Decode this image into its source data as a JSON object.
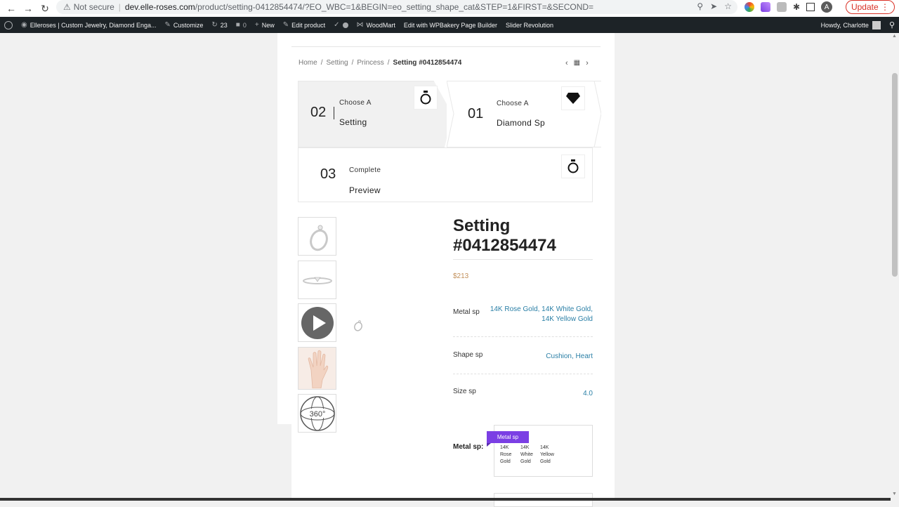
{
  "browser": {
    "security": "Not secure",
    "url_host": "dev.elle-roses.com",
    "url_path": "/product/setting-0412854474/?EO_WBC=1&BEGIN=eo_setting_shape_cat&STEP=1&FIRST=&SECOND=",
    "avatar_letter": "A",
    "update_label": "Update"
  },
  "adminbar": {
    "site": "Elleroses | Custom Jewelry, Diamond Enga...",
    "customize": "Customize",
    "updates": "23",
    "comments": "0",
    "new": "New",
    "edit_product": "Edit product",
    "woodmart": "WoodMart",
    "wpbakery": "Edit with WPBakery Page Builder",
    "slider": "Slider Revolution",
    "howdy": "Howdy, Charlotte"
  },
  "breadcrumb": {
    "home": "Home",
    "sep": "/",
    "setting": "Setting",
    "princess": "Princess",
    "current": "Setting #0412854474"
  },
  "steps": [
    {
      "num": "02",
      "label": "Choose A",
      "title": "Setting"
    },
    {
      "num": "01",
      "label": "Choose A",
      "title": "Diamond Sp"
    },
    {
      "num": "03",
      "label": "Complete",
      "title": "Preview"
    }
  ],
  "product": {
    "title": "Setting #0412854474",
    "price": "$213",
    "attributes": [
      {
        "label": "Metal sp",
        "value_line1": "14K Rose Gold, 14K White Gold,",
        "value_line2": "14K Yellow Gold"
      },
      {
        "label": "Shape sp",
        "value_line1": "Cushion, Heart",
        "value_line2": ""
      },
      {
        "label": "Size sp",
        "value_line1": "4.0",
        "value_line2": ""
      }
    ],
    "swatch": {
      "label": "Metal sp:",
      "tooltip": "Metal sp",
      "options": [
        {
          "l1": "14K",
          "l2": "Rose",
          "l3": "Gold"
        },
        {
          "l1": "14K",
          "l2": "White",
          "l3": "Gold"
        },
        {
          "l1": "14K",
          "l2": "Yellow",
          "l3": "Gold"
        }
      ]
    }
  },
  "gallery": {
    "badge_360": "360°"
  }
}
